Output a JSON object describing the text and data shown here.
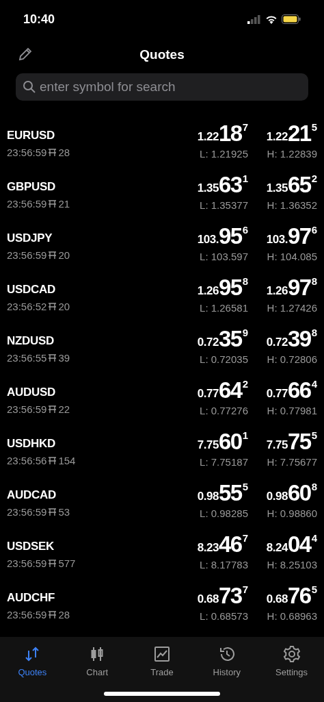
{
  "status_bar": {
    "time": "10:40"
  },
  "header": {
    "title": "Quotes"
  },
  "search": {
    "placeholder": "enter symbol for search"
  },
  "quotes": [
    {
      "symbol": "EURUSD",
      "time": "23:56:59",
      "spread": "28",
      "bid": {
        "prefix": "1.22",
        "big": "18",
        "pip": "7"
      },
      "ask": {
        "prefix": "1.22",
        "big": "21",
        "pip": "5"
      },
      "low": "L: 1.21925",
      "high": "H: 1.22839"
    },
    {
      "symbol": "GBPUSD",
      "time": "23:56:59",
      "spread": "21",
      "bid": {
        "prefix": "1.35",
        "big": "63",
        "pip": "1"
      },
      "ask": {
        "prefix": "1.35",
        "big": "65",
        "pip": "2"
      },
      "low": "L: 1.35377",
      "high": "H: 1.36352"
    },
    {
      "symbol": "USDJPY",
      "time": "23:56:59",
      "spread": "20",
      "bid": {
        "prefix": "103.",
        "big": "95",
        "pip": "6"
      },
      "ask": {
        "prefix": "103.",
        "big": "97",
        "pip": "6"
      },
      "low": "L: 103.597",
      "high": "H: 104.085"
    },
    {
      "symbol": "USDCAD",
      "time": "23:56:52",
      "spread": "20",
      "bid": {
        "prefix": "1.26",
        "big": "95",
        "pip": "8"
      },
      "ask": {
        "prefix": "1.26",
        "big": "97",
        "pip": "8"
      },
      "low": "L: 1.26581",
      "high": "H: 1.27426"
    },
    {
      "symbol": "NZDUSD",
      "time": "23:56:55",
      "spread": "39",
      "bid": {
        "prefix": "0.72",
        "big": "35",
        "pip": "9"
      },
      "ask": {
        "prefix": "0.72",
        "big": "39",
        "pip": "8"
      },
      "low": "L: 0.72035",
      "high": "H: 0.72806"
    },
    {
      "symbol": "AUDUSD",
      "time": "23:56:59",
      "spread": "22",
      "bid": {
        "prefix": "0.77",
        "big": "64",
        "pip": "2"
      },
      "ask": {
        "prefix": "0.77",
        "big": "66",
        "pip": "4"
      },
      "low": "L: 0.77276",
      "high": "H: 0.77981"
    },
    {
      "symbol": "USDHKD",
      "time": "23:56:56",
      "spread": "154",
      "bid": {
        "prefix": "7.75",
        "big": "60",
        "pip": "1"
      },
      "ask": {
        "prefix": "7.75",
        "big": "75",
        "pip": "5"
      },
      "low": "L: 7.75187",
      "high": "H: 7.75677"
    },
    {
      "symbol": "AUDCAD",
      "time": "23:56:59",
      "spread": "53",
      "bid": {
        "prefix": "0.98",
        "big": "55",
        "pip": "5"
      },
      "ask": {
        "prefix": "0.98",
        "big": "60",
        "pip": "8"
      },
      "low": "L: 0.98285",
      "high": "H: 0.98860"
    },
    {
      "symbol": "USDSEK",
      "time": "23:56:59",
      "spread": "577",
      "bid": {
        "prefix": "8.23",
        "big": "46",
        "pip": "7"
      },
      "ask": {
        "prefix": "8.24",
        "big": "04",
        "pip": "4"
      },
      "low": "L: 8.17783",
      "high": "H: 8.25103"
    },
    {
      "symbol": "AUDCHF",
      "time": "23:56:59",
      "spread": "28",
      "bid": {
        "prefix": "0.68",
        "big": "73",
        "pip": "7"
      },
      "ask": {
        "prefix": "0.68",
        "big": "76",
        "pip": "5"
      },
      "low": "L: 0.68573",
      "high": "H: 0.68963"
    }
  ],
  "tabs": [
    {
      "kind": "quotes",
      "label": "Quotes",
      "selected": true
    },
    {
      "kind": "chart",
      "label": "Chart",
      "selected": false
    },
    {
      "kind": "trade",
      "label": "Trade",
      "selected": false
    },
    {
      "kind": "history",
      "label": "History",
      "selected": false
    },
    {
      "kind": "settings",
      "label": "Settings",
      "selected": false
    }
  ]
}
